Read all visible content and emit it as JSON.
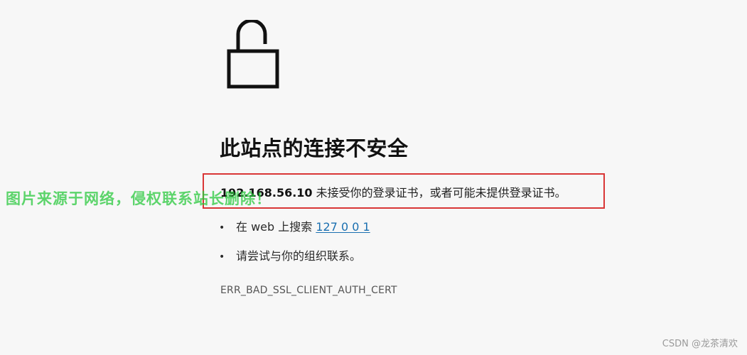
{
  "page": {
    "title": "此站点的连接不安全",
    "message": {
      "host": "192.168.56.10",
      "text": "未接受你的登录证书，或者可能未提供登录证书。"
    },
    "suggestions": [
      {
        "prefix": "在 web 上搜索",
        "link": "127 0 0 1"
      },
      {
        "text": "请尝试与你的组织联系。"
      }
    ],
    "error_code": "ERR_BAD_SSL_CLIENT_AUTH_CERT",
    "bullet": "•"
  },
  "overlays": {
    "watermark": "图片来源于网络，侵权联系站长删除！",
    "credit": "CSDN @龙茶清欢",
    "highlight_color": "#d93636",
    "watermark_color": "#28c83c"
  },
  "icons": {
    "lock": "unlocked-padlock-icon"
  }
}
